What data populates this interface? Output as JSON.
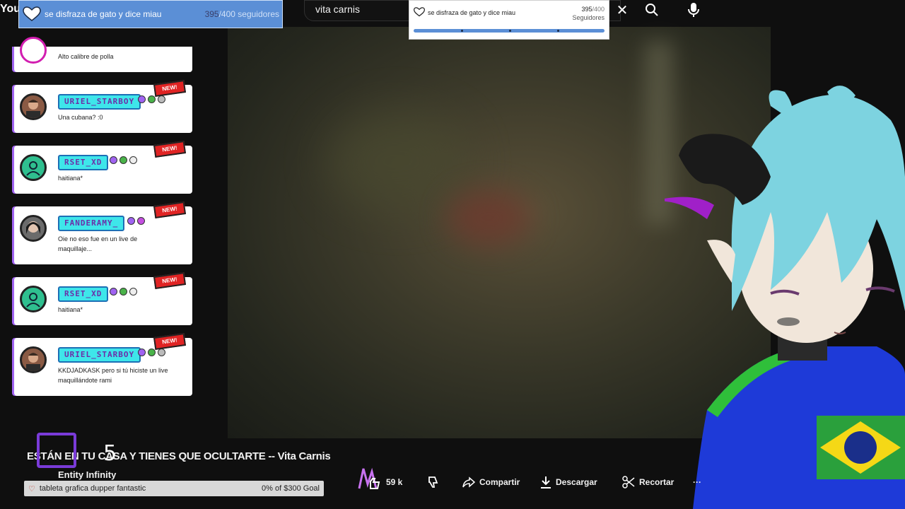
{
  "youtube": {
    "logo": "You",
    "search_value": "vita carnis",
    "close_label": "✕"
  },
  "goal_top": {
    "title": "se disfraza de gato y dice miau",
    "current": "395",
    "total": "/400 seguidores"
  },
  "goal_mid": {
    "title": "se disfraza de gato y dice miau",
    "current": "395",
    "total": "/400",
    "unit": "Seguidores",
    "progress": 0.9875
  },
  "chat": {
    "partial_message": "Alto calibre de polla",
    "messages": [
      {
        "name": "URIEL_STARBOY",
        "text": "Una cubana? :0",
        "new": "NEW!"
      },
      {
        "name": "RSET_XD",
        "text": "haitiana*",
        "new": "NEW!"
      },
      {
        "name": "FANDERAMY_",
        "text": "Oie no eso fue en un live de maquillaje...",
        "new": "NEW!"
      },
      {
        "name": "RSET_XD",
        "text": "haitiana*",
        "new": "NEW!"
      },
      {
        "name": "URIEL_STARBOY",
        "text": "KKDJADKASK pero si tú hiciste un live maquillándote rami",
        "new": "NEW!"
      }
    ]
  },
  "video": {
    "title": "ESTÁN EN TU CASA Y TIENES QUE OCULTARTE -- Vita Carnis",
    "channel": "Entity Infinity",
    "counter": "5",
    "likes": "59 k",
    "share": "Compartir",
    "download": "Descargar",
    "clip": "Recortar",
    "more": "···"
  },
  "donation_goal": {
    "label": "tableta grafica dupper fantastic",
    "status": "0% of $300 Goal"
  },
  "colors": {
    "goal_blue": "#5b8fd6",
    "name_cyan": "#3ee6ea",
    "twitch_purple": "#7a3bd8",
    "new_red": "#e02323"
  }
}
